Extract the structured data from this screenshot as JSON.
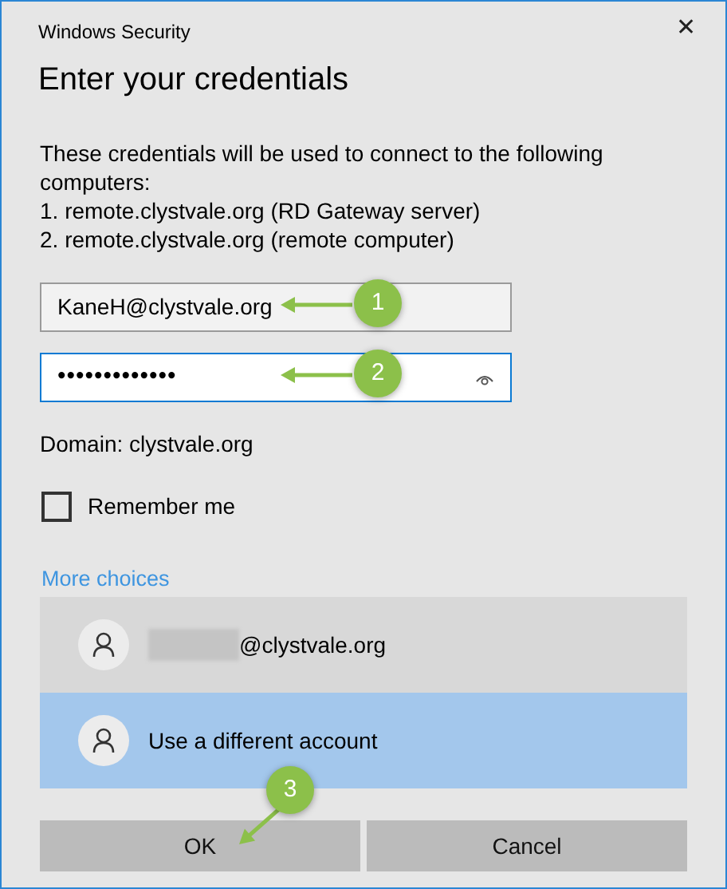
{
  "window": {
    "title": "Windows Security",
    "close": "✕"
  },
  "heading": "Enter your credentials",
  "message": [
    "These credentials will be used to connect to the following computers:",
    "1. remote.clystvale.org (RD Gateway server)",
    "2. remote.clystvale.org (remote computer)"
  ],
  "fields": [
    {
      "kind": "text",
      "value": "KaneH@clystvale.org",
      "focused": false,
      "callout": "1"
    },
    {
      "kind": "password",
      "value": "•••••••••••••",
      "focused": true,
      "callout": "2"
    }
  ],
  "domain": "Domain: clystvale.org",
  "remember": {
    "label": "Remember me",
    "checked": false
  },
  "more_choices": "More choices",
  "accounts": [
    {
      "label": "@clystvale.org",
      "redacted": true,
      "selected": false
    },
    {
      "label": "Use a different account",
      "redacted": false,
      "selected": true
    }
  ],
  "buttons": [
    {
      "label": "OK",
      "callout": "3"
    },
    {
      "label": "Cancel"
    }
  ]
}
